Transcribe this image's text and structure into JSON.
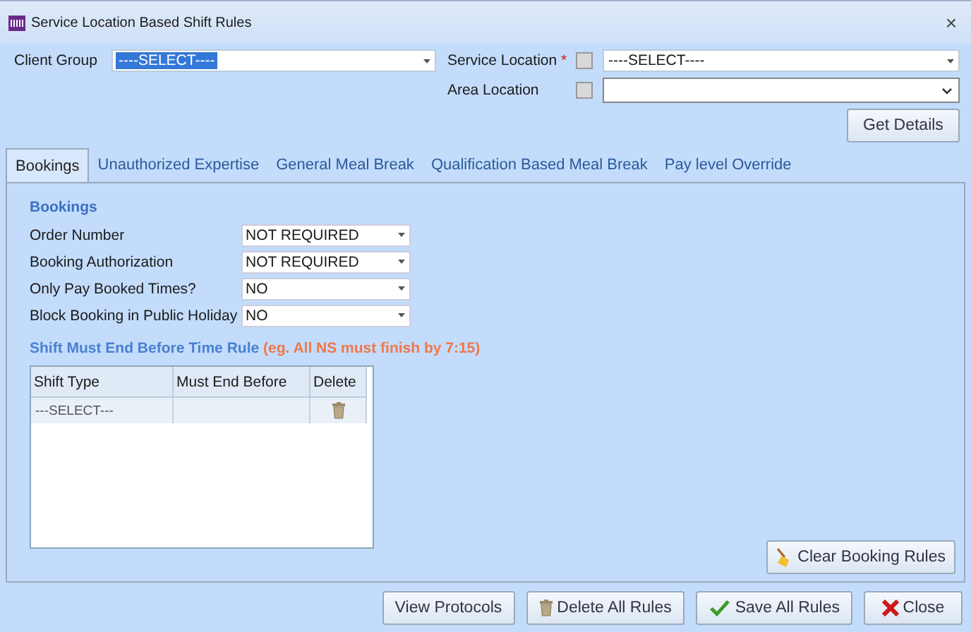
{
  "window": {
    "title": "Service Location Based Shift Rules",
    "close": "×"
  },
  "client_group": {
    "label": "Client Group",
    "value": "----SELECT----"
  },
  "service_location": {
    "label": "Service Location",
    "required": "*",
    "checked": false,
    "value": "----SELECT----"
  },
  "area_location": {
    "label": "Area Location",
    "checked": false
  },
  "get_details": "Get Details",
  "tabs": [
    {
      "label": "Bookings",
      "selected": true
    },
    {
      "label": "Unauthorized Expertise",
      "selected": false
    },
    {
      "label": "General Meal Break",
      "selected": false
    },
    {
      "label": "Qualification Based Meal Break",
      "selected": false
    },
    {
      "label": "Pay level Override",
      "selected": false
    }
  ],
  "bookings": {
    "heading": "Bookings",
    "fields": [
      {
        "label": "Order Number",
        "value": "NOT REQUIRED"
      },
      {
        "label": "Booking Authorization",
        "value": "NOT REQUIRED"
      },
      {
        "label": "Only Pay Booked Times?",
        "value": "NO"
      },
      {
        "label": "Block Booking in Public Holiday",
        "value": "NO"
      }
    ]
  },
  "shift_rule": {
    "heading": "Shift Must End Before Time Rule",
    "note": "(eg. All NS must finish by 7:15)",
    "columns": [
      "Shift Type",
      "Must End Before",
      "Delete"
    ],
    "rows": [
      {
        "shift_type": "---SELECT---",
        "must_end_before": ""
      }
    ]
  },
  "clear_button": "Clear Booking Rules",
  "buttons": [
    {
      "label": "View Protocols",
      "kind": "plain"
    },
    {
      "label": "Delete All Rules",
      "kind": "delete"
    },
    {
      "label": "Save All Rules",
      "kind": "save"
    },
    {
      "label": "Close",
      "kind": "close"
    }
  ]
}
